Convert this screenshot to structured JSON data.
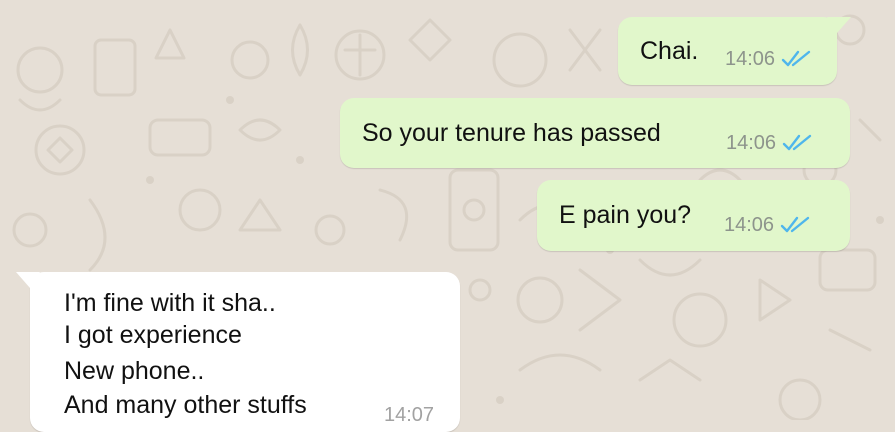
{
  "chat": {
    "messages": [
      {
        "direction": "outgoing",
        "text": "Chai.",
        "time": "14:06",
        "status": "read-double-tick-icon"
      },
      {
        "direction": "outgoing",
        "text": "So your tenure has passed",
        "time": "14:06",
        "status": "read-double-tick-icon"
      },
      {
        "direction": "outgoing",
        "text": "E pain you?",
        "time": "14:06",
        "status": "read-double-tick-icon"
      },
      {
        "direction": "incoming",
        "lines": [
          "I'm fine with it sha..",
          "I got experience",
          "New phone..",
          "And many other stuffs"
        ],
        "time": "14:07"
      }
    ]
  },
  "colors": {
    "background": "#e6dfd6",
    "outgoing_bubble": "#e1f7cb",
    "incoming_bubble": "#ffffff",
    "read_tick": "#4fb6ec",
    "timestamp": "#8d948c"
  }
}
